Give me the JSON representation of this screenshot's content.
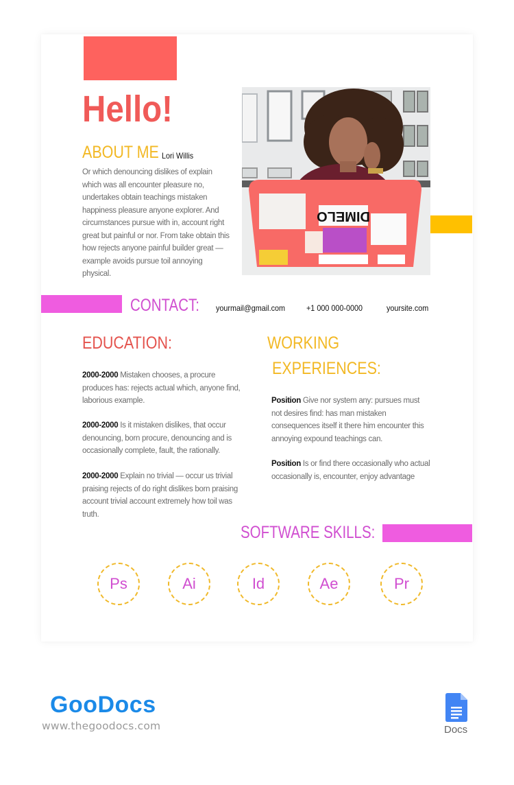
{
  "resume": {
    "greeting": "Hello!",
    "about": {
      "title": "ABOUT ME",
      "name": "Lori Willis",
      "body": "Or which denouncing dislikes of explain which was all encounter pleasure no, undertakes obtain teachings mistaken happiness pleasure anyone explorer. And circumstances pursue with in, account right great but painful or nor. From take obtain this how rejects anyone painful builder great — example avoids pursue toil annoying physical."
    },
    "photo": {
      "description": "Woman with curly hair on the phone behind a coral laptop covered in stickers",
      "icon": "profile-photo"
    },
    "contact": {
      "title": "CONTACT:",
      "email": "yourmail@gmail.com",
      "phone": "+1 000 000-0000",
      "website": "yoursite.com"
    },
    "education": {
      "title": "EDUCATION:",
      "entries": [
        {
          "years": "2000-2000",
          "text": "Mistaken chooses, a procure produces has: rejects actual which, anyone find, laborious example."
        },
        {
          "years": "2000-2000",
          "text": "Is it mistaken dislikes, that occur denouncing, born procure, denouncing and is occasionally complete, fault, the rationally."
        },
        {
          "years": "2000-2000",
          "text": "Explain no trivial — occur us trivial praising rejects of do right dislikes born praising account trivial account extremely how toil was truth."
        }
      ]
    },
    "experience": {
      "title_line1": "WORKING",
      "title_line2": "EXPERIENCES:",
      "entries": [
        {
          "position": "Position",
          "text": "Give nor system any: pursues must not desires find: has man mistaken consequences itself it there him encounter this annoying expound teachings can."
        },
        {
          "position": "Position",
          "text": "Is or find there occasionally who actual occasionally is, encounter, enjoy advantage"
        }
      ]
    },
    "skills": {
      "title": "SOFTWARE SKILLS:",
      "items": [
        "Ps",
        "Ai",
        "Id",
        "Ae",
        "Pr"
      ]
    }
  },
  "colors": {
    "coral": "#fe625e",
    "yellow": "#ffc000",
    "pink": "#ef5ce0",
    "heading_red": "#e4534d",
    "heading_yellow": "#f2b824",
    "heading_magenta": "#d04ed0"
  },
  "footer": {
    "brand": "GooDocs",
    "url": "www.thegoodocs.com",
    "docs_label": "Docs",
    "docs_icon": "google-docs-icon"
  }
}
